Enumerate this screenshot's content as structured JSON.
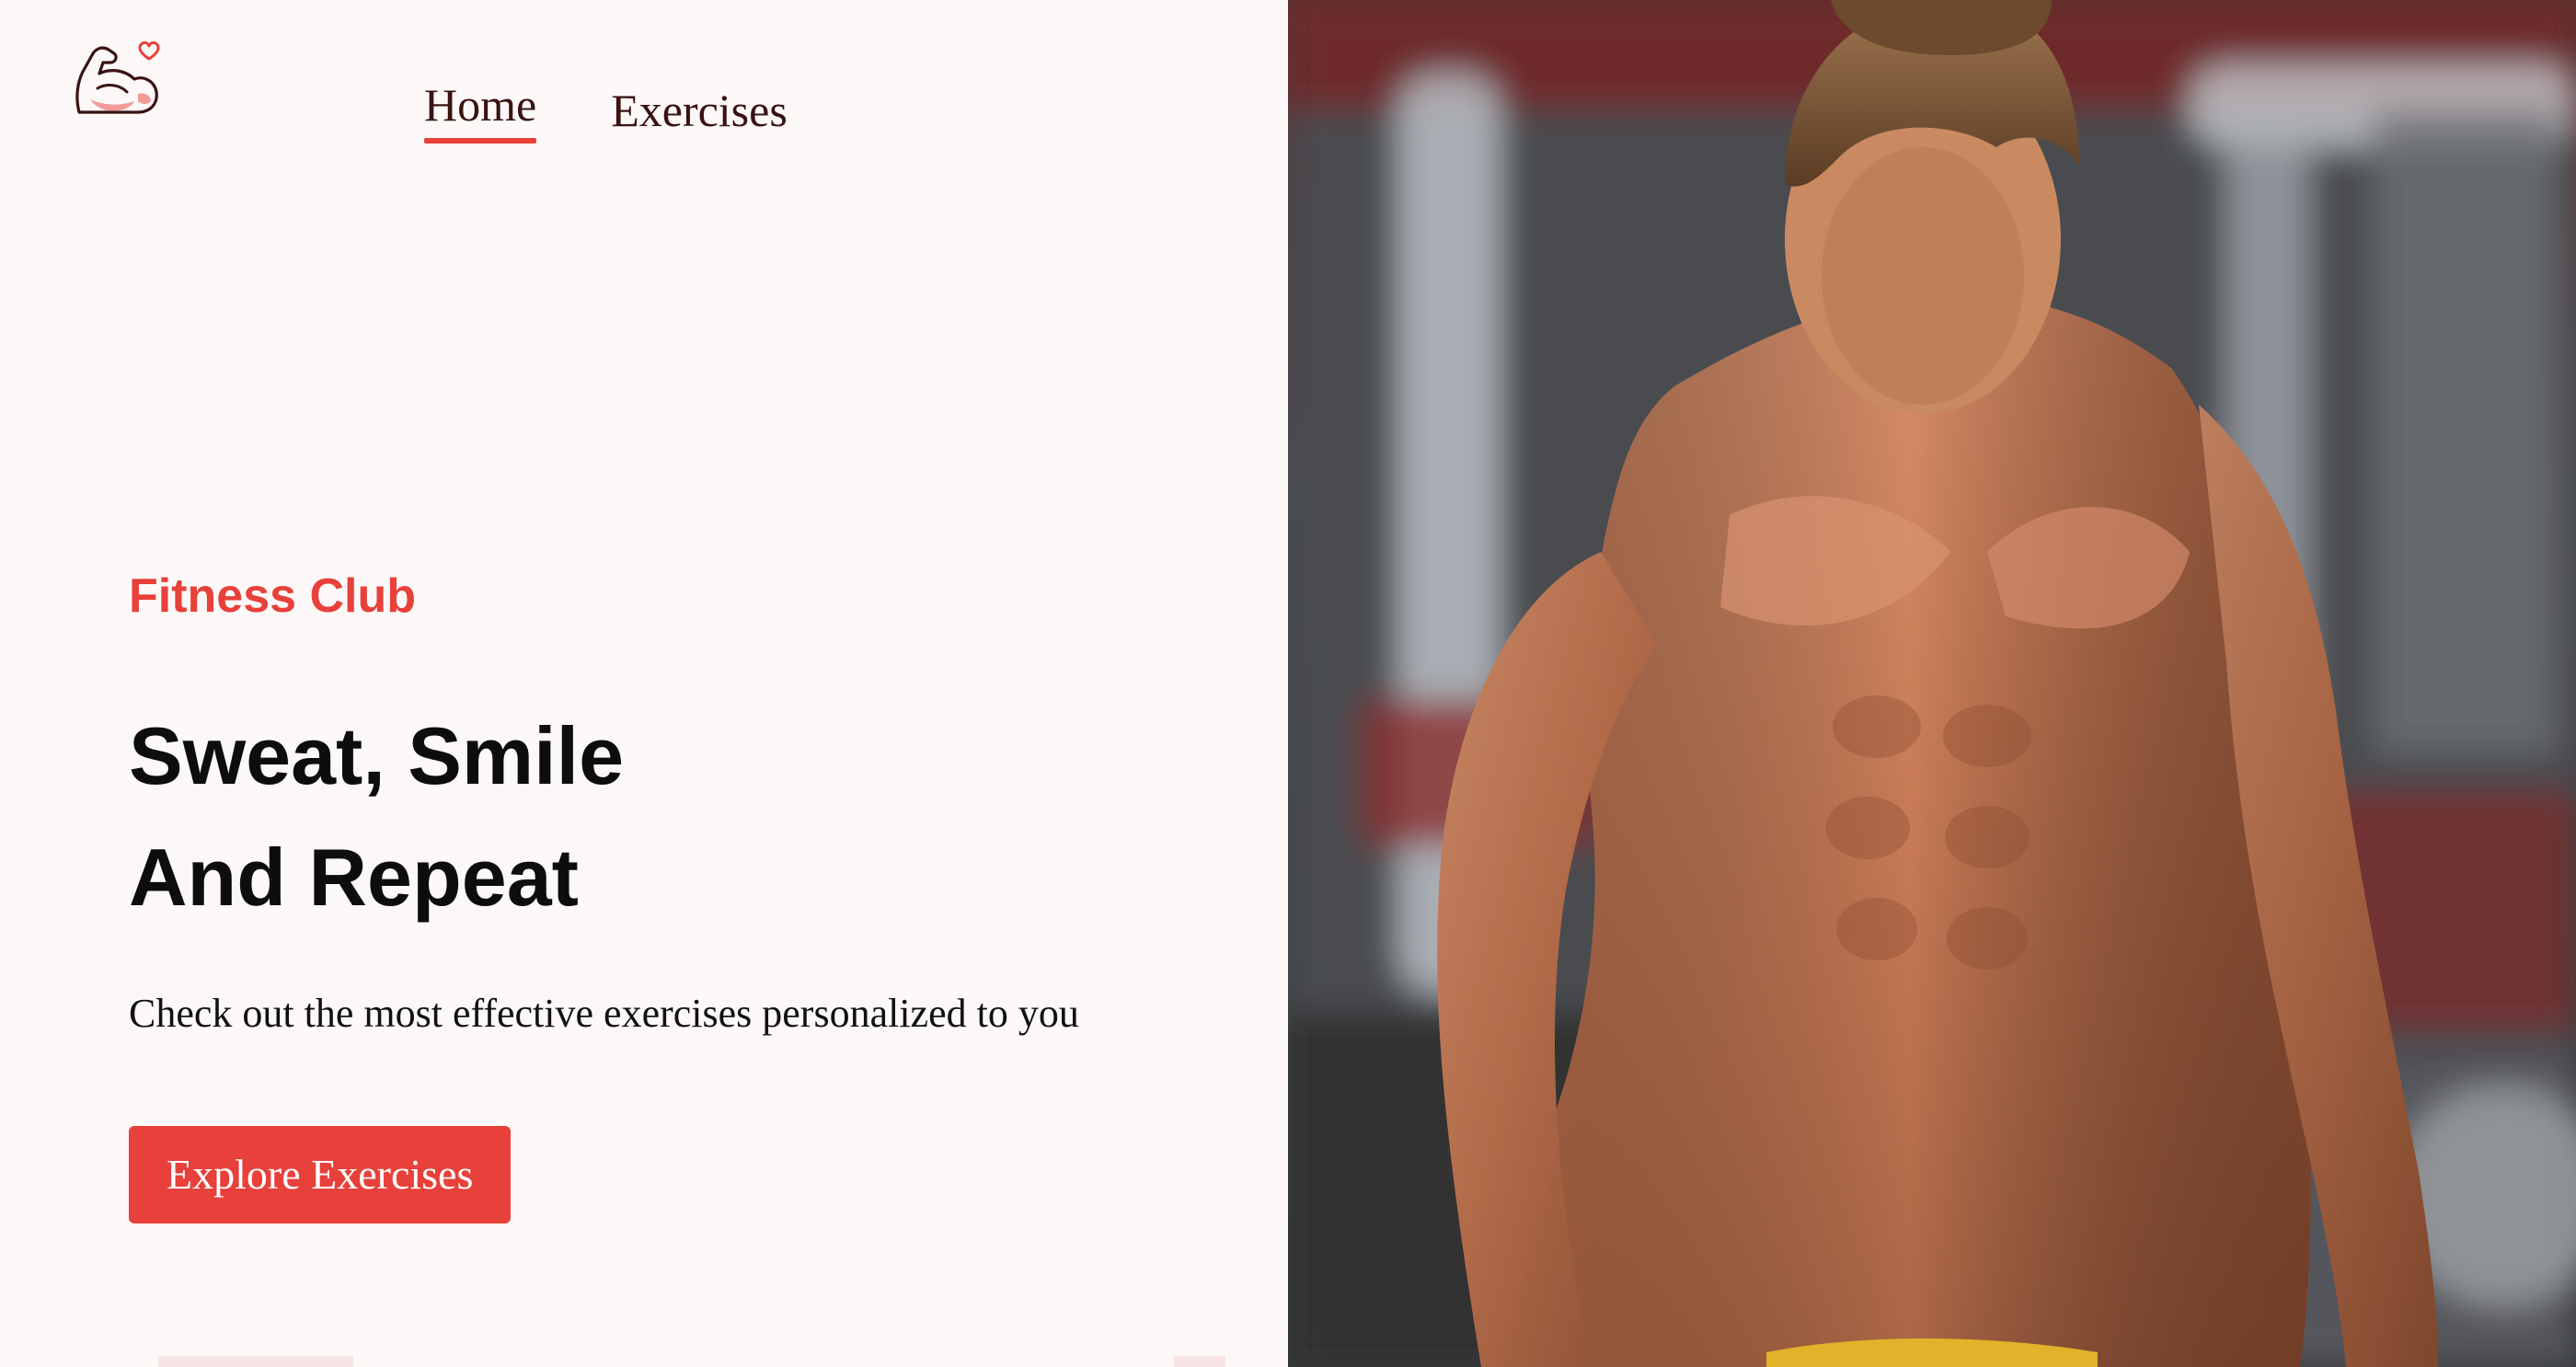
{
  "nav": {
    "items": [
      {
        "label": "Home",
        "active": true
      },
      {
        "label": "Exercises",
        "active": false
      }
    ]
  },
  "hero": {
    "eyebrow": "Fitness Club",
    "headline_line1": "Sweat, Smile",
    "headline_line2": "And Repeat",
    "subtext": "Check out the most effective exercises personalized to you",
    "cta_label": "Explore Exercises"
  },
  "icons": {
    "logo": "flexed-bicep-heart-icon"
  },
  "colors": {
    "accent": "#e8403a",
    "background": "#fcf8f8",
    "nav_text": "#3a1212",
    "heading": "#0d0d0d"
  }
}
